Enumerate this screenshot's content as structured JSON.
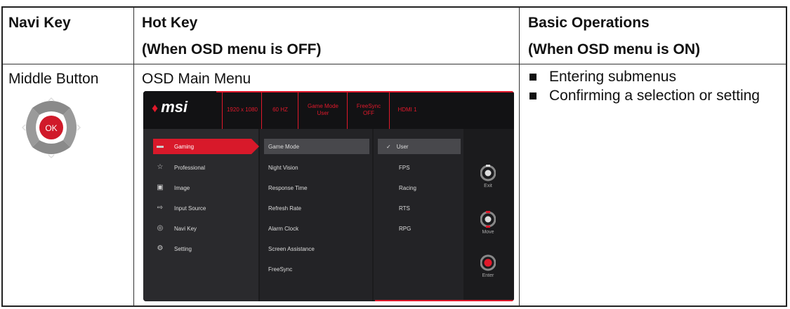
{
  "headers": {
    "col1": "Navi Key",
    "col2_line1": "Hot Key",
    "col2_line2": "(When OSD menu is OFF)",
    "col3_line1": "Basic Operations",
    "col3_line2": "(When OSD menu is ON)"
  },
  "row": {
    "navi_key": "Middle Button",
    "ok_label": "OK",
    "hot_key": "OSD Main Menu",
    "operations": [
      "Entering submenus",
      "Confirming a selection or setting"
    ]
  },
  "osd": {
    "logo": "msi",
    "status": [
      {
        "line1": "1920 x 1080",
        "line2": ""
      },
      {
        "line1": "60 HZ",
        "line2": ""
      },
      {
        "line1": "Game Mode",
        "line2": "User"
      },
      {
        "line1": "FreeSync",
        "line2": "OFF"
      },
      {
        "line1": "HDMI 1",
        "line2": ""
      }
    ],
    "menu": [
      {
        "label": "Gaming",
        "icon": "gamepad-icon",
        "glyph": "▬"
      },
      {
        "label": "Professional",
        "icon": "star-icon",
        "glyph": "☆"
      },
      {
        "label": "Image",
        "icon": "image-icon",
        "glyph": "▣"
      },
      {
        "label": "Input Source",
        "icon": "input-source-icon",
        "glyph": "⇨"
      },
      {
        "label": "Navi Key",
        "icon": "navi-key-icon",
        "glyph": "◎"
      },
      {
        "label": "Setting",
        "icon": "gear-icon",
        "glyph": "⚙"
      }
    ],
    "submenu": [
      "Game Mode",
      "Night Vision",
      "Response Time",
      "Refresh Rate",
      "Alarm Clock",
      "Screen Assistance",
      "FreeSync"
    ],
    "options": [
      "User",
      "FPS",
      "Racing",
      "RTS",
      "RPG"
    ],
    "check": "✓",
    "controls": [
      "Exit",
      "Move",
      "Enter"
    ],
    "accent": "#e1192b"
  }
}
